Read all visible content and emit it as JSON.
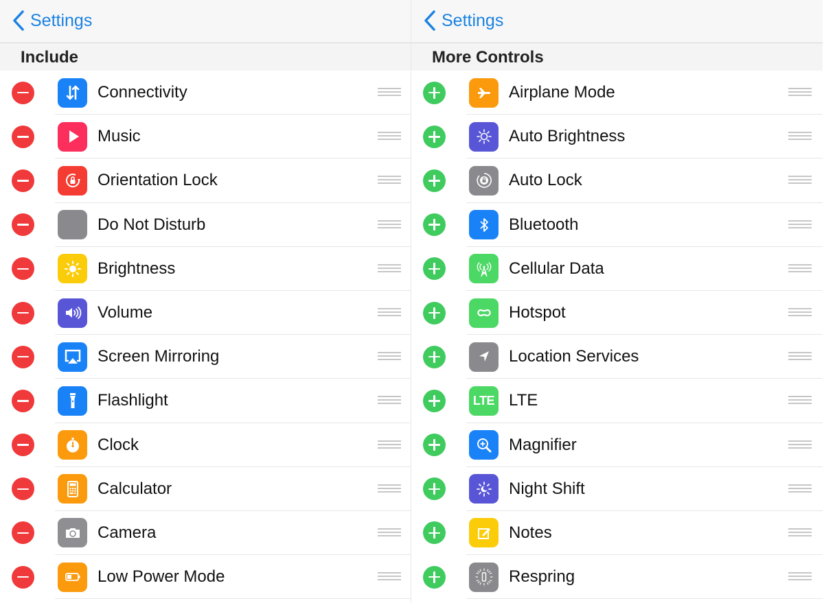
{
  "left": {
    "nav": {
      "back_label": "Settings"
    },
    "section_title": "Include",
    "action": "remove",
    "items": [
      {
        "label": "Connectivity",
        "icon": "connectivity-icon",
        "color": "#1a82f7"
      },
      {
        "label": "Music",
        "icon": "music-play-icon",
        "color": "#fb2e5c"
      },
      {
        "label": "Orientation Lock",
        "icon": "orientation-lock-icon",
        "color": "#f43c32"
      },
      {
        "label": "Do Not Disturb",
        "icon": "do-not-disturb-icon",
        "color": "#8a8a8e"
      },
      {
        "label": "Brightness",
        "icon": "brightness-icon",
        "color": "#fbcc0a"
      },
      {
        "label": "Volume",
        "icon": "volume-icon",
        "color": "#5856d6"
      },
      {
        "label": "Screen Mirroring",
        "icon": "screen-mirroring-icon",
        "color": "#1a82f7"
      },
      {
        "label": "Flashlight",
        "icon": "flashlight-icon",
        "color": "#1a82f7"
      },
      {
        "label": "Clock",
        "icon": "stopwatch-icon",
        "color": "#fb9a0c"
      },
      {
        "label": "Calculator",
        "icon": "calculator-icon",
        "color": "#fb9a0c"
      },
      {
        "label": "Camera",
        "icon": "camera-icon",
        "color": "#8e8e93"
      },
      {
        "label": "Low Power Mode",
        "icon": "battery-icon",
        "color": "#fb9a0c"
      }
    ]
  },
  "right": {
    "nav": {
      "back_label": "Settings"
    },
    "section_title": "More Controls",
    "action": "add",
    "items": [
      {
        "label": "Airplane Mode",
        "icon": "airplane-icon",
        "color": "#fb9a0c"
      },
      {
        "label": "Auto Brightness",
        "icon": "auto-brightness-icon",
        "color": "#5856d6"
      },
      {
        "label": "Auto Lock",
        "icon": "auto-lock-icon",
        "color": "#8a8a8e"
      },
      {
        "label": "Bluetooth",
        "icon": "bluetooth-icon",
        "color": "#1a82f7"
      },
      {
        "label": "Cellular Data",
        "icon": "cellular-antenna-icon",
        "color": "#4cd864"
      },
      {
        "label": "Hotspot",
        "icon": "hotspot-icon",
        "color": "#4cd864"
      },
      {
        "label": "Location Services",
        "icon": "location-arrow-icon",
        "color": "#8a8a8e"
      },
      {
        "label": "LTE",
        "icon": "lte-icon",
        "color": "#4cd864",
        "icon_text": "LTE"
      },
      {
        "label": "Magnifier",
        "icon": "magnifier-icon",
        "color": "#1a82f7"
      },
      {
        "label": "Night Shift",
        "icon": "night-shift-icon",
        "color": "#5856d6"
      },
      {
        "label": "Notes",
        "icon": "notes-icon",
        "color": "#fbcc0a"
      },
      {
        "label": "Respring",
        "icon": "respring-icon",
        "color": "#8a8a8e"
      }
    ]
  }
}
